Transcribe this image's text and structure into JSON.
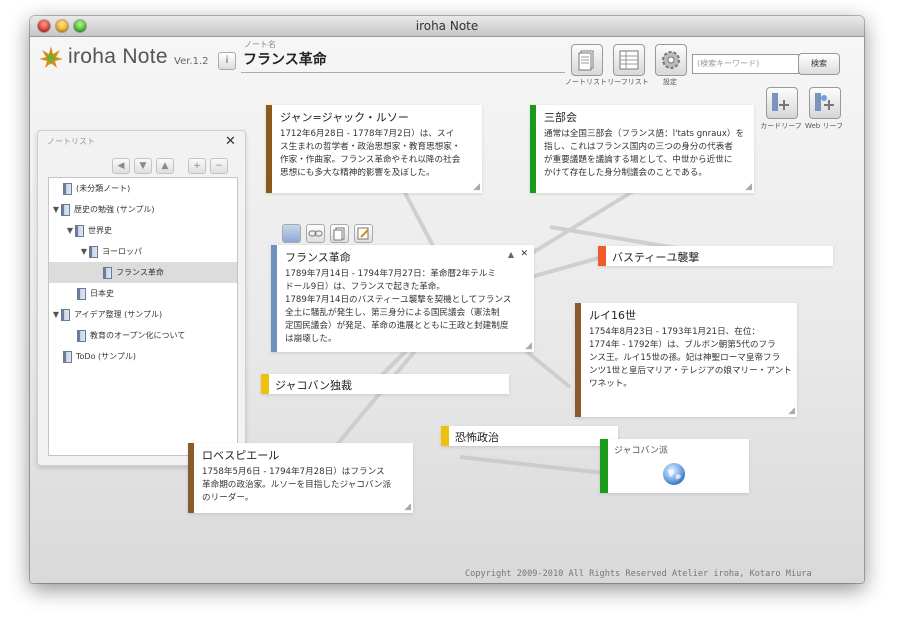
{
  "window": {
    "title": "iroha Note"
  },
  "app": {
    "name": "iroha Note",
    "version": "Ver.1.2",
    "info": "i"
  },
  "note_name": {
    "label": "ノート名",
    "value": "フランス革命"
  },
  "toolbar": {
    "note_list_label": "ノートリスト",
    "leaf_list_label": "リーフリスト",
    "settings_label": "設定",
    "search_placeholder": "(検索キーワード)",
    "search_button": "検索",
    "card_leaf_label": "カードリーフ",
    "web_leaf_label": "Web リーフ"
  },
  "notelist": {
    "title": "ノートリスト",
    "close": "✕",
    "tools": [
      "◀",
      "▼",
      "▲",
      "+",
      "−"
    ],
    "items": [
      {
        "label": "(未分類ノート)",
        "depth": 0,
        "expanded": null
      },
      {
        "label": "歴史の勉強 (サンプル)",
        "depth": 0,
        "expanded": true
      },
      {
        "label": "世界史",
        "depth": 1,
        "expanded": true
      },
      {
        "label": "ヨーロッパ",
        "depth": 2,
        "expanded": true
      },
      {
        "label": "フランス革命",
        "depth": 3,
        "expanded": null,
        "selected": true
      },
      {
        "label": "日本史",
        "depth": 1,
        "expanded": null
      },
      {
        "label": "アイデア整理 (サンプル)",
        "depth": 0,
        "expanded": true
      },
      {
        "label": "教育のオープン化について",
        "depth": 1,
        "expanded": null
      },
      {
        "label": "ToDo (サンプル)",
        "depth": 0,
        "expanded": null
      }
    ]
  },
  "cards": {
    "rousseau": {
      "title": "ジャン=ジャック・ルソー",
      "color": "#8b5a1b",
      "lines": [
        "1712年6月28日 - 1778年7月2日）は、スイ",
        "ス生まれの哲学者・政治思想家・教育思想家・",
        "作家・作曲家。フランス革命やそれ以降の社会",
        "思想にも多大な精神的影響を及ぼした。"
      ]
    },
    "estates": {
      "title": "三部会",
      "color": "#1a9a1a",
      "lines": [
        "通常は全国三部会（フランス語：l'tats gnraux）を",
        "指し、これはフランス国内の三つの身分の代表者",
        "が重要議題を議論する場として、中世から近世に",
        "かけて存在した身分制議会のことである。"
      ]
    },
    "revolution": {
      "title": "フランス革命",
      "color": "#7090c0",
      "lines": [
        "1789年7月14日 - 1794年7月27日：革命暦2年テルミ",
        "ドール9日）は、フランスで起きた革命。",
        "1789年7月14日のバスティーユ襲撃を契機としてフランス",
        "全土に騒乱が発生し、第三身分による国民議会（憲法制",
        "定国民議会）が発足、革命の進展とともに王政と封建制度",
        "は崩壊した。"
      ]
    },
    "bastille": {
      "title": "バスティーユ襲撃",
      "color": "#f05a28"
    },
    "louis": {
      "title": "ルイ16世",
      "color": "#8b5a2b",
      "lines": [
        "1754年8月23日 - 1793年1月21日、在位：",
        "1774年 - 1792年）は、ブルボン朝第5代のフラ",
        "ンス王。ルイ15世の孫。妃は神聖ローマ皇帝フラ",
        "ンツ1世と皇后マリア・テレジアの娘マリー・アント",
        "ワネット。"
      ]
    },
    "jacobin_dict": {
      "title": "ジャコバン独裁",
      "color": "#f0c010"
    },
    "terror": {
      "title": "恐怖政治",
      "color": "#f0c010"
    },
    "robespierre": {
      "title": "ロベスピエール",
      "color": "#8b5a2b",
      "lines": [
        "1758年5月6日 - 1794年7月28日）はフランス",
        "革命期の政治家。ルソーを目指したジャコバン派",
        "のリーダー。"
      ]
    },
    "jacobins": {
      "title": "ジャコバン派",
      "color": "#1a9a1a"
    }
  },
  "footer": {
    "copyright": "Copyright 2009-2010 All Rights Reserved Atelier iroha, Kotaro Miura"
  }
}
